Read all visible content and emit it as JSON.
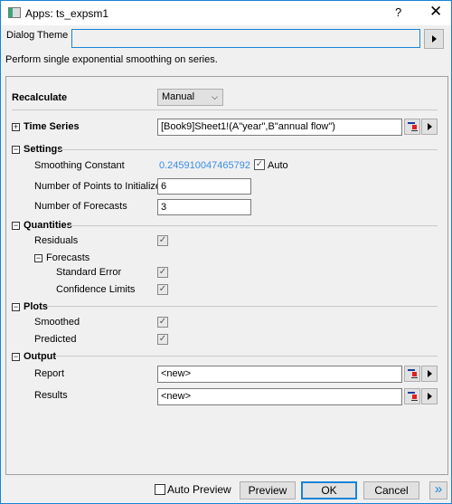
{
  "window": {
    "title": "Apps: ts_expsm1",
    "help": "?",
    "close": "✕"
  },
  "theme": {
    "label": "Dialog Theme",
    "value": ""
  },
  "description": "Perform single exponential smoothing on series.",
  "recalculate": {
    "label": "Recalculate",
    "value": "Manual"
  },
  "time_series": {
    "label": "Time Series",
    "value": "[Book9]Sheet1!(A\"year\",B\"annual flow\")"
  },
  "settings": {
    "label": "Settings",
    "smoothing_label": "Smoothing Constant",
    "smoothing_value": "0.245910047465792",
    "auto_label": "Auto",
    "auto_checked": true,
    "init_label": "Number of Points to Initialize",
    "init_value": "6",
    "forecasts_label": "Number of Forecasts",
    "forecasts_value": "3"
  },
  "quantities": {
    "label": "Quantities",
    "residuals": "Residuals",
    "forecasts": "Forecasts",
    "std_error": "Standard Error",
    "conf_limits": "Confidence Limits"
  },
  "plots": {
    "label": "Plots",
    "smoothed": "Smoothed",
    "predicted": "Predicted"
  },
  "output": {
    "label": "Output",
    "report_label": "Report",
    "report_value": "<new>",
    "results_label": "Results",
    "results_value": "<new>"
  },
  "footer": {
    "auto_preview": "Auto Preview",
    "preview": "Preview",
    "ok": "OK",
    "cancel": "Cancel",
    "more": "»"
  },
  "colors": {
    "accent": "#1883d7",
    "link": "#3c8ce7"
  }
}
